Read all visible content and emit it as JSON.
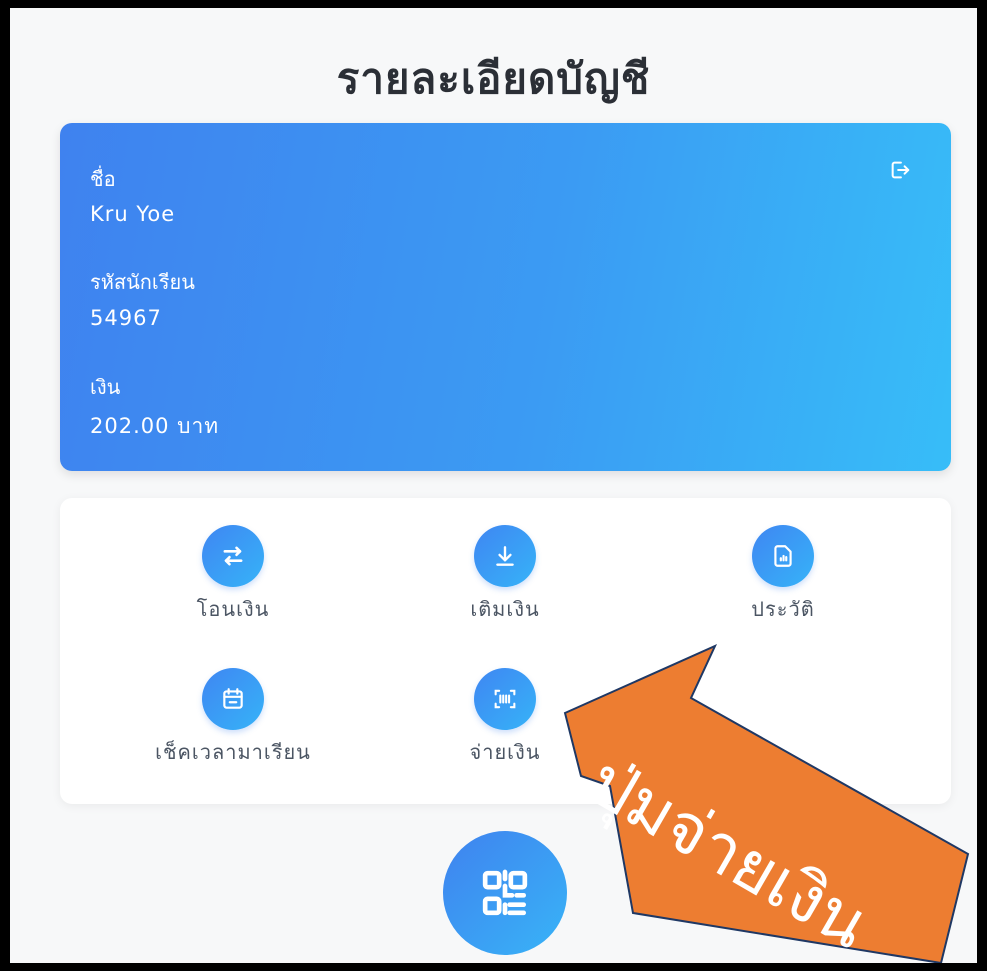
{
  "header": {
    "title": "รายละเอียดบัญชี"
  },
  "account": {
    "name_label": "ชื่อ",
    "name_value": "Kru Yoe",
    "student_id_label": "รหัสนักเรียน",
    "student_id_value": "54967",
    "balance_label": "เงิน",
    "balance_value": "202.00 บาท",
    "logout_icon": "logout-icon"
  },
  "menu": {
    "items": [
      {
        "label": "โอนเงิน",
        "icon": "transfer-icon"
      },
      {
        "label": "เติมเงิน",
        "icon": "download-icon"
      },
      {
        "label": "ประวัติ",
        "icon": "report-icon"
      },
      {
        "label": "เช็คเวลามาเรียน",
        "icon": "calendar-icon"
      },
      {
        "label": "จ่ายเงิน",
        "icon": "barcode-scan-icon"
      }
    ]
  },
  "fab": {
    "icon": "qr-code-icon"
  },
  "annotation": {
    "text": "ปุ่มจ่ายเงิน"
  },
  "colors": {
    "accent_start": "#3f82ef",
    "accent_end": "#37bdf8",
    "arrow_fill": "#ed7d31",
    "arrow_outline": "#1f3864"
  }
}
